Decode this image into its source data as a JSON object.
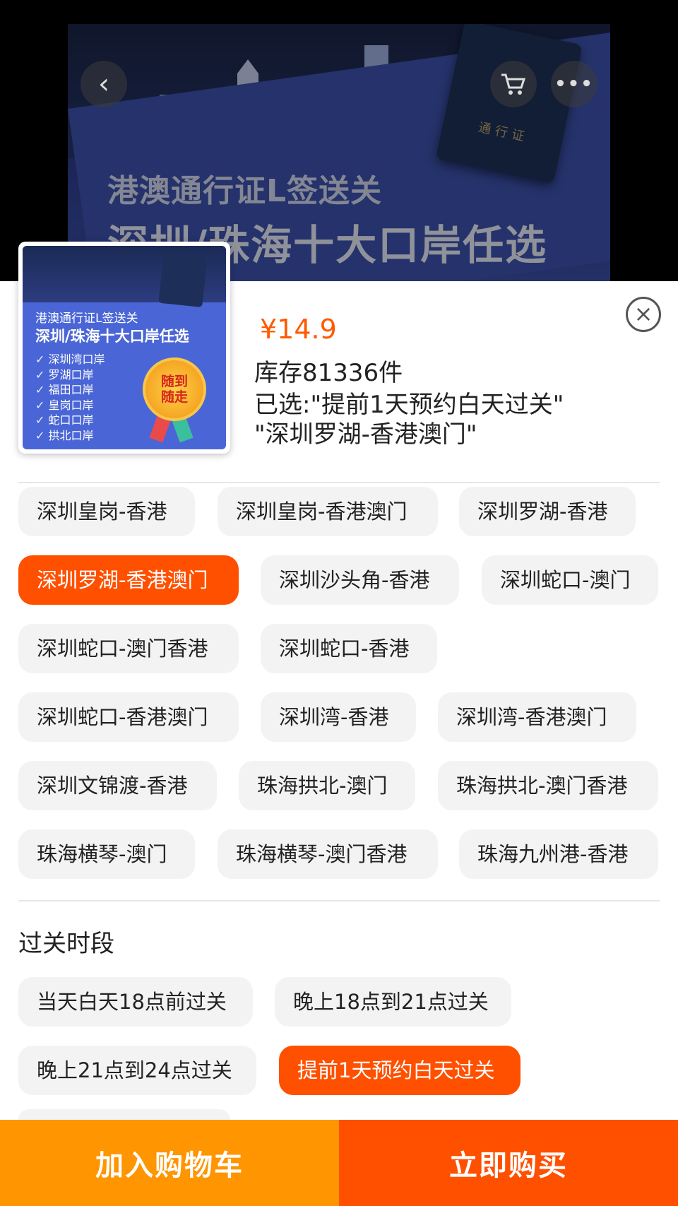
{
  "banner": {
    "line1": "港澳通行证L签送关",
    "line2": "深圳/珠海十大口岸任选",
    "passport_text": "通行证"
  },
  "header_icons": {
    "back": "chevron-left-icon",
    "cart": "cart-icon",
    "more": "more-dots-icon"
  },
  "thumbnail": {
    "title1": "港澳通行证L签送关",
    "title2": "深圳/珠海十大口岸任选",
    "ports": [
      "深圳湾口岸",
      "罗湖口岸",
      "福田口岸",
      "皇岗口岸",
      "蛇口口岸",
      "拱北口岸"
    ],
    "medal_line1": "随到",
    "medal_line2": "随走"
  },
  "product": {
    "price": "¥14.9",
    "stock": "库存81336件",
    "selected_line1": "已选:\"提前1天预约白天过关\"",
    "selected_line2": "\"深圳罗湖-香港澳门\""
  },
  "routes": [
    "深圳皇岗-香港",
    "深圳皇岗-香港澳门",
    "深圳罗湖-香港",
    "深圳罗湖-香港澳门",
    "深圳沙头角-香港",
    "深圳蛇口-澳门",
    "深圳蛇口-澳门香港",
    "深圳蛇口-香港",
    "深圳蛇口-香港澳门",
    "深圳湾-香港",
    "深圳湾-香港澳门",
    "深圳文锦渡-香港",
    "珠海拱北-澳门",
    "珠海拱北-澳门香港",
    "珠海横琴-澳门",
    "珠海横琴-澳门香港",
    "珠海九州港-香港"
  ],
  "selected_route": "深圳罗湖-香港澳门",
  "time_section": {
    "title": "过关时段",
    "options": [
      "当天白天18点前过关",
      "晚上18点到21点过关",
      "晚上21点到24点过关",
      "提前1天预约白天过关"
    ],
    "selected": "提前1天预约白天过关"
  },
  "actions": {
    "add_to_cart": "加入购物车",
    "buy_now": "立即购买"
  },
  "colors": {
    "accent": "#ff5000",
    "cart_button": "#ff9500",
    "chip_bg": "#f3f3f3"
  }
}
